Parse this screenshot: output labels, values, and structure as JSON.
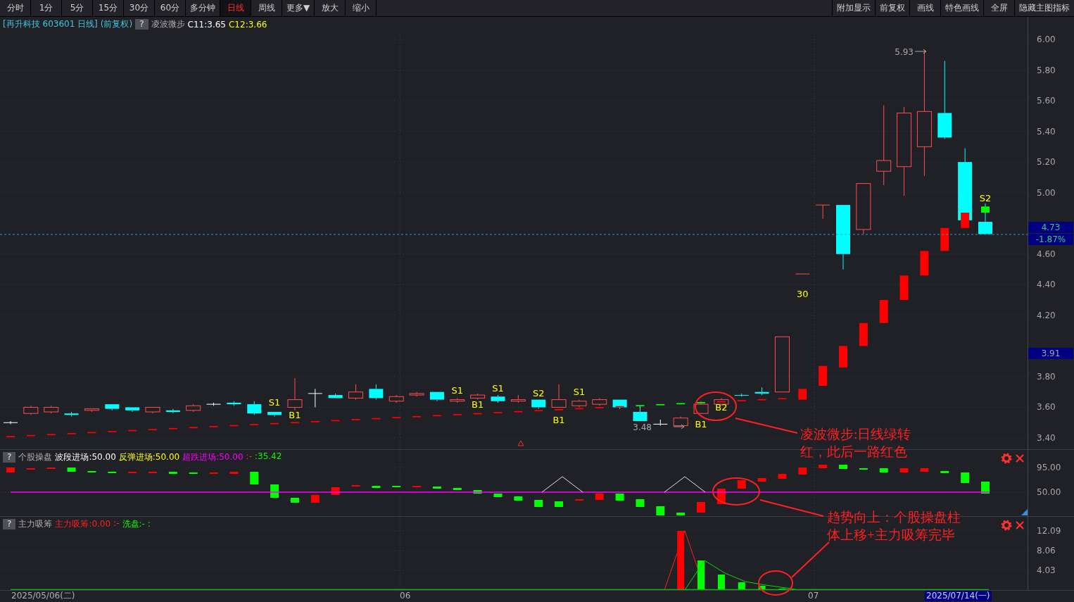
{
  "toolbar": {
    "periods": [
      {
        "label": "分时",
        "selected": false
      },
      {
        "label": "1分",
        "selected": false
      },
      {
        "label": "5分",
        "selected": false
      },
      {
        "label": "15分",
        "selected": false
      },
      {
        "label": "30分",
        "selected": false
      },
      {
        "label": "60分",
        "selected": false
      },
      {
        "label": "多分钟",
        "selected": false
      },
      {
        "label": "日线",
        "selected": true
      },
      {
        "label": "周线",
        "selected": false
      },
      {
        "label": "更多▼",
        "selected": false
      },
      {
        "label": "放大",
        "selected": false
      },
      {
        "label": "缩小",
        "selected": false
      }
    ],
    "actions": [
      "附加显示",
      "前复权",
      "画线",
      "特色画线",
      "全屏",
      "隐藏主图指标"
    ]
  },
  "main_chart": {
    "title": "[再升科技 603601 日线]",
    "adjust": "(前复权)",
    "help": "?",
    "indicator": "凌波微步",
    "values": [
      {
        "text": "C11:3.65",
        "color": "#ffffff"
      },
      {
        "text": "C12:3.66",
        "color": "#ffff00"
      }
    ],
    "signals": [
      "S1",
      "B1",
      "S1",
      "B1",
      "S1",
      "S2",
      "B1",
      "S1",
      "B1",
      "B2",
      "30",
      "S2"
    ],
    "high_label": "5.93",
    "low_label": "3.48",
    "axis": [
      "6.00",
      "5.80",
      "5.60",
      "5.40",
      "5.20",
      "5.00",
      "4.60",
      "4.40",
      "4.20",
      "3.80",
      "3.60",
      "3.40"
    ],
    "price_tags": [
      {
        "text": "4.73",
        "kind": "last"
      },
      {
        "text": "-1.87%",
        "kind": "change"
      },
      {
        "text": "3.91",
        "kind": "cursor"
      }
    ]
  },
  "sub_panels": [
    {
      "help": "?",
      "name": "个股操盘",
      "values": [
        {
          "text": "波段进场:50.00",
          "color": "#ffffff"
        },
        {
          "text": "反弹进场:50.00",
          "color": "#ffff00"
        },
        {
          "text": "超跌进场:50.00",
          "color": "#ff00ff"
        },
        {
          "text": ":-",
          "color": "#ff3030"
        },
        {
          "text": ":35.42",
          "color": "#00ff00"
        }
      ],
      "axis": [
        "95.00",
        "50.00"
      ]
    },
    {
      "help": "?",
      "name": "主力吸筹",
      "values": [
        {
          "text": "主力吸筹:0.00",
          "color": "#ff2020"
        },
        {
          "text": ":-",
          "color": "#ff3030"
        },
        {
          "text": "洗盘:- :",
          "color": "#00ff00"
        }
      ],
      "axis": [
        "12.09",
        "8.06",
        "4.03"
      ]
    }
  ],
  "annotations": [
    "凌波微步:日线绿转红，此后一路红色",
    "趋势向上：个股操盘柱体上移+主力吸筹完毕"
  ],
  "date_axis": [
    {
      "text": "2025/05/06(二)",
      "selected": false
    },
    {
      "text": "06",
      "selected": false
    },
    {
      "text": "07",
      "selected": false
    },
    {
      "text": "2025/07/14(一)",
      "selected": true
    }
  ]
}
